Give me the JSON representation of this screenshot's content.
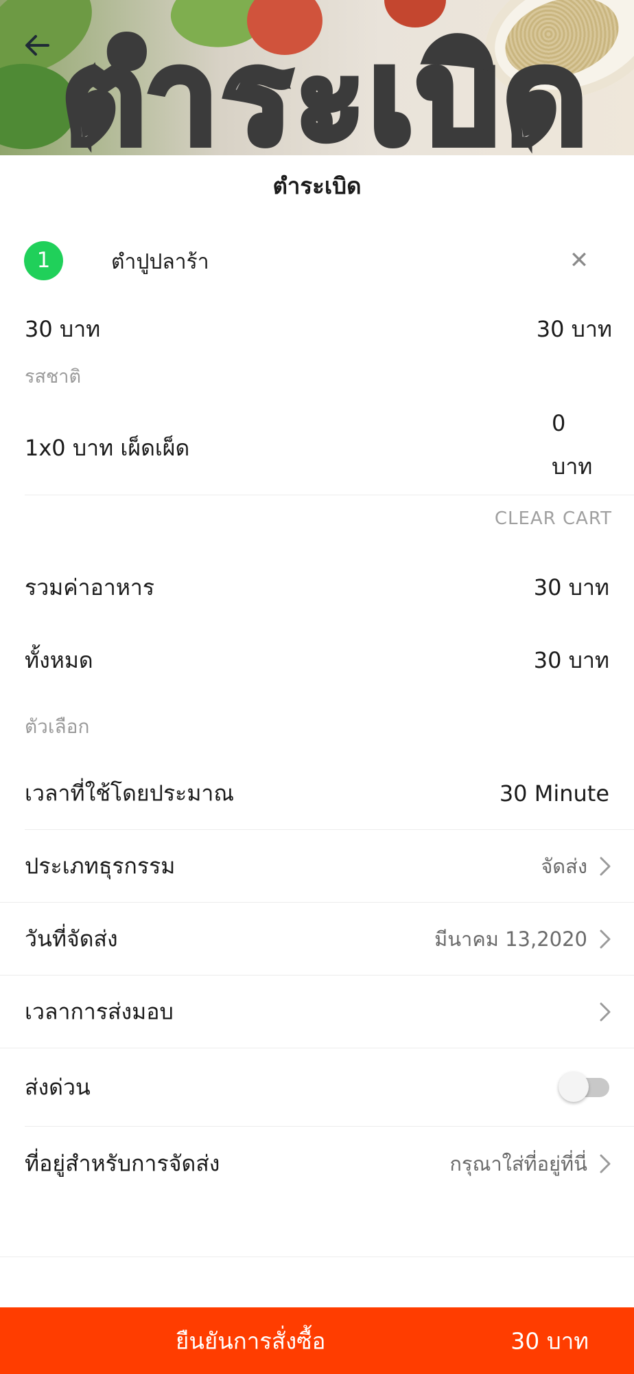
{
  "banner": {
    "logo_text": "ตำระเบิด"
  },
  "header": {
    "title": "ตำระเบิด"
  },
  "cart": {
    "item": {
      "quantity": "1",
      "name": "ตำปูปลาร้า",
      "unit_price": "30 บาท",
      "line_total": "30 บาท",
      "option_group_label": "รสชาติ",
      "option_detail": "1x0 บาท  เผ็ดเผ็ด",
      "option_price_amount": "0",
      "option_price_unit": "บาท"
    },
    "clear_cart_label": "CLEAR CART"
  },
  "summary": {
    "food_total_label": "รวมค่าอาหาร",
    "food_total_value": "30 บาท",
    "grand_total_label": "ทั้งหมด",
    "grand_total_value": "30 บาท"
  },
  "options": {
    "section_label": "ตัวเลือก",
    "est_time_label": "เวลาที่ใช้โดยประมาณ",
    "est_time_value": "30 Minute",
    "business_type_label": "ประเภทธุรกรรม",
    "business_type_value": "จัดส่ง",
    "delivery_date_label": "วันที่จัดส่ง",
    "delivery_date_value": "มีนาคม 13,2020",
    "delivery_time_label": "เวลาการส่งมอบ",
    "express_label": "ส่งด่วน",
    "express_enabled": false,
    "address_label": "ที่อยู่สำหรับการจัดส่ง",
    "address_placeholder": "กรุณาใส่ที่อยู่ที่นี่"
  },
  "confirm": {
    "label": "ยืนยันการสั่งซื้อ",
    "total": "30 บาท"
  },
  "colors": {
    "accent": "#ff3d00",
    "badge": "#20d05a",
    "muted_text": "#9a9a9a"
  },
  "icons": {
    "back": "arrow-left-icon",
    "remove": "close-icon",
    "chevron": "chevron-right-icon"
  }
}
